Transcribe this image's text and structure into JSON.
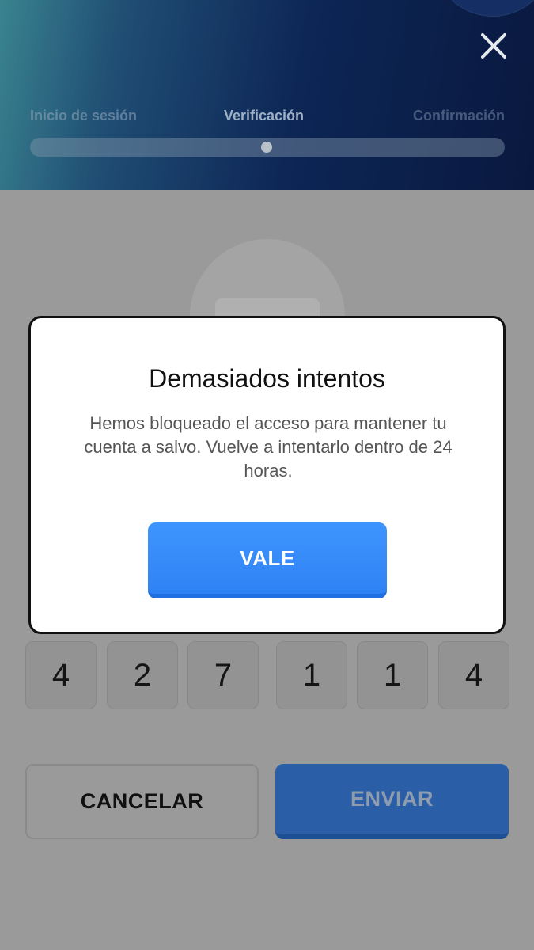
{
  "header": {
    "steps": [
      "Inicio de sesión",
      "Verificación",
      "Confirmación"
    ],
    "active_step": 2,
    "close_icon": "close-icon"
  },
  "code": {
    "digits": [
      "4",
      "2",
      "7",
      "1",
      "1",
      "4"
    ]
  },
  "actions": {
    "cancel_label": "CANCELAR",
    "send_label": "ENVIAR"
  },
  "modal": {
    "title": "Demasiados intentos",
    "message": "Hemos bloqueado el acceso para mantener tu cuenta a salvo. Vuelve a intentarlo dentro de 24 horas.",
    "ok_label": "VALE"
  },
  "colors": {
    "accent": "#3a8cff",
    "overlay": "#9a9a9a",
    "header_dark": "#0a1b44"
  }
}
